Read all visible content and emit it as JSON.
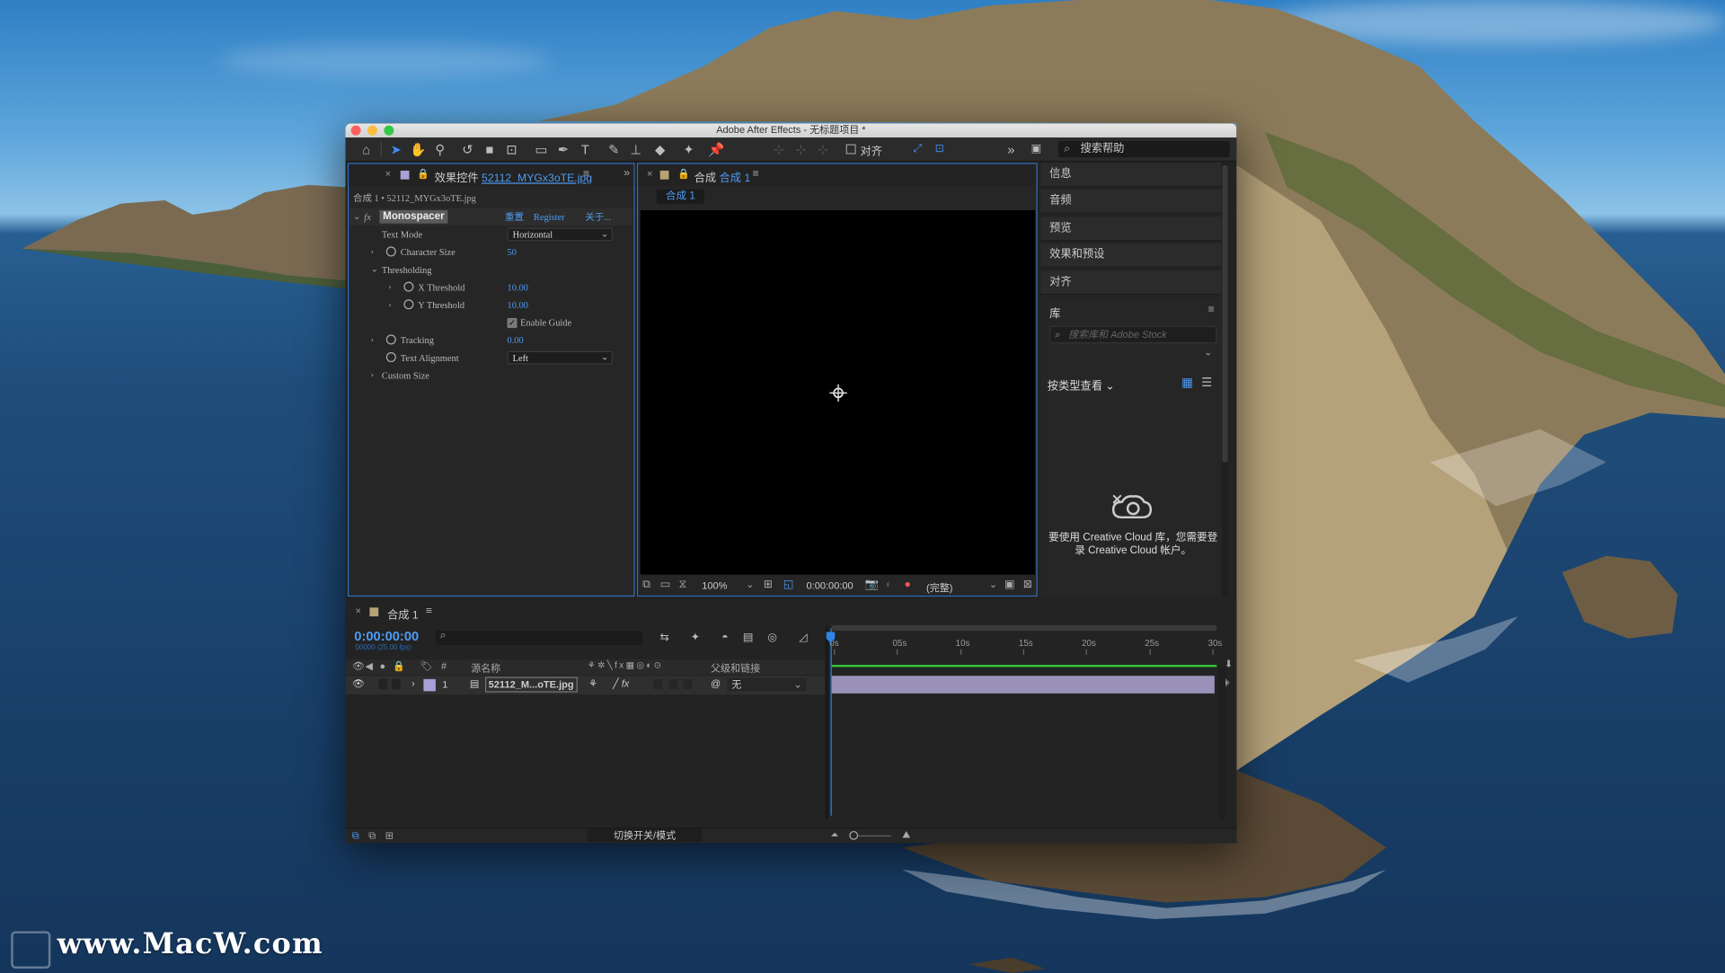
{
  "window": {
    "title": "Adobe After Effects - 无标题项目 *"
  },
  "toolbar": {
    "align_label": "对齐",
    "help_search_placeholder": "搜索帮助"
  },
  "effects_panel": {
    "tab_prefix": "效果控件",
    "tab_file": "52112_MYGx3oTE.jpg",
    "breadcrumb": "合成 1 • 52112_MYGx3oTE.jpg",
    "effect_name": "Monospacer",
    "fx_label": "fx",
    "links": [
      "重置",
      "Register",
      "关于..."
    ],
    "rows": [
      {
        "label": "Text Mode",
        "value": "Horizontal",
        "type": "dropdown"
      },
      {
        "label": "Character Size",
        "value": "50",
        "type": "number"
      },
      {
        "label": "Thresholding",
        "type": "group"
      },
      {
        "label": "X Threshold",
        "value": "10.00",
        "type": "number"
      },
      {
        "label": "Y Threshold",
        "value": "10.00",
        "type": "number"
      },
      {
        "label": "Enable Guide",
        "checked": true,
        "type": "checkbox"
      },
      {
        "label": "Tracking",
        "value": "0.00",
        "type": "number"
      },
      {
        "label": "Text Alignment",
        "value": "Left",
        "type": "dropdown"
      },
      {
        "label": "Custom Size",
        "type": "group"
      }
    ]
  },
  "composition_panel": {
    "tab_prefix": "合成",
    "tab_name": "合成 1",
    "comp_chip": "合成 1",
    "zoom": "100%",
    "timecode": "0:00:00:00",
    "resolution": "(完整)"
  },
  "right_panels": {
    "items": [
      "信息",
      "音频",
      "预览",
      "效果和预设",
      "对齐"
    ],
    "library": {
      "title": "库",
      "search_placeholder": "搜索库和 Adobe Stock",
      "view_by": "按类型查看",
      "cc_message": "要使用 Creative Cloud 库，您需要登录 Creative Cloud 帐户。"
    }
  },
  "timeline": {
    "tab_name": "合成 1",
    "timecode": "0:00:00:00",
    "fps": "00000 (25.00 fps)",
    "headers": {
      "hash": "#",
      "source_name": "源名称",
      "parent": "父级和链接"
    },
    "layers": [
      {
        "index": "1",
        "name": "52112_M...oTE.jpg",
        "parent": "无"
      }
    ],
    "ruler_ticks": [
      "0s",
      "05s",
      "10s",
      "15s",
      "20s",
      "25s",
      "30s"
    ],
    "toggle_label": "切换开关/模式"
  },
  "watermark": "www.MacW.com",
  "colors": {
    "accent": "#4d9bf5",
    "panel_bg": "#262626",
    "layer_bar": "#9a92b8",
    "work_area": "#35c43c"
  }
}
